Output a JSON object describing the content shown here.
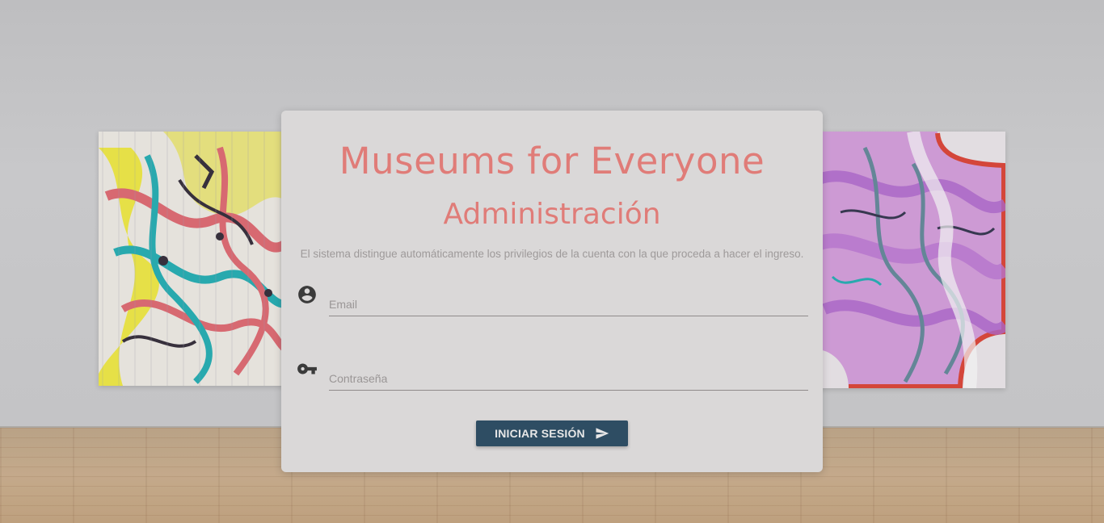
{
  "login": {
    "title": "Museums for Everyone",
    "subtitle": "Administración",
    "description": "El sistema distingue automáticamente los privilegios de la cuenta con la que proceda a hacer el ingreso.",
    "email": {
      "placeholder": "Email",
      "value": "",
      "icon": "account-circle-icon"
    },
    "password": {
      "placeholder": "Contraseña",
      "value": "",
      "icon": "key-icon"
    },
    "submit": {
      "label": "INICIAR SESIÓN",
      "icon": "send-icon"
    }
  },
  "colors": {
    "title": "#e07c78",
    "button": "#2e4d63",
    "card": "#dad8d8"
  }
}
